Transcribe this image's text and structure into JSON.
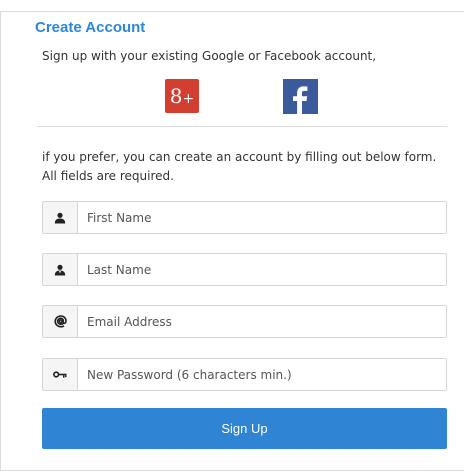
{
  "form": {
    "title": "Create Account",
    "intro": "Sign up with your existing Google or Facebook account,",
    "social": {
      "google_label": "8+",
      "google_icon": "google-plus-icon",
      "facebook_label": "f",
      "facebook_icon": "facebook-icon",
      "google_color": "#d23f31",
      "facebook_color": "#3b5a9b"
    },
    "prefer_text": "if you prefer, you can create an account by filling out below form. All fields are required.",
    "fields": [
      {
        "placeholder": "First Name",
        "icon": "user-icon"
      },
      {
        "placeholder": "Last Name",
        "icon": "user-alt-icon"
      },
      {
        "placeholder": "Email Address",
        "icon": "at-icon"
      },
      {
        "placeholder": "New Password (6 characters min.)",
        "icon": "key-icon"
      }
    ],
    "submit_label": "Sign Up",
    "accent_color": "#2f84d4"
  }
}
